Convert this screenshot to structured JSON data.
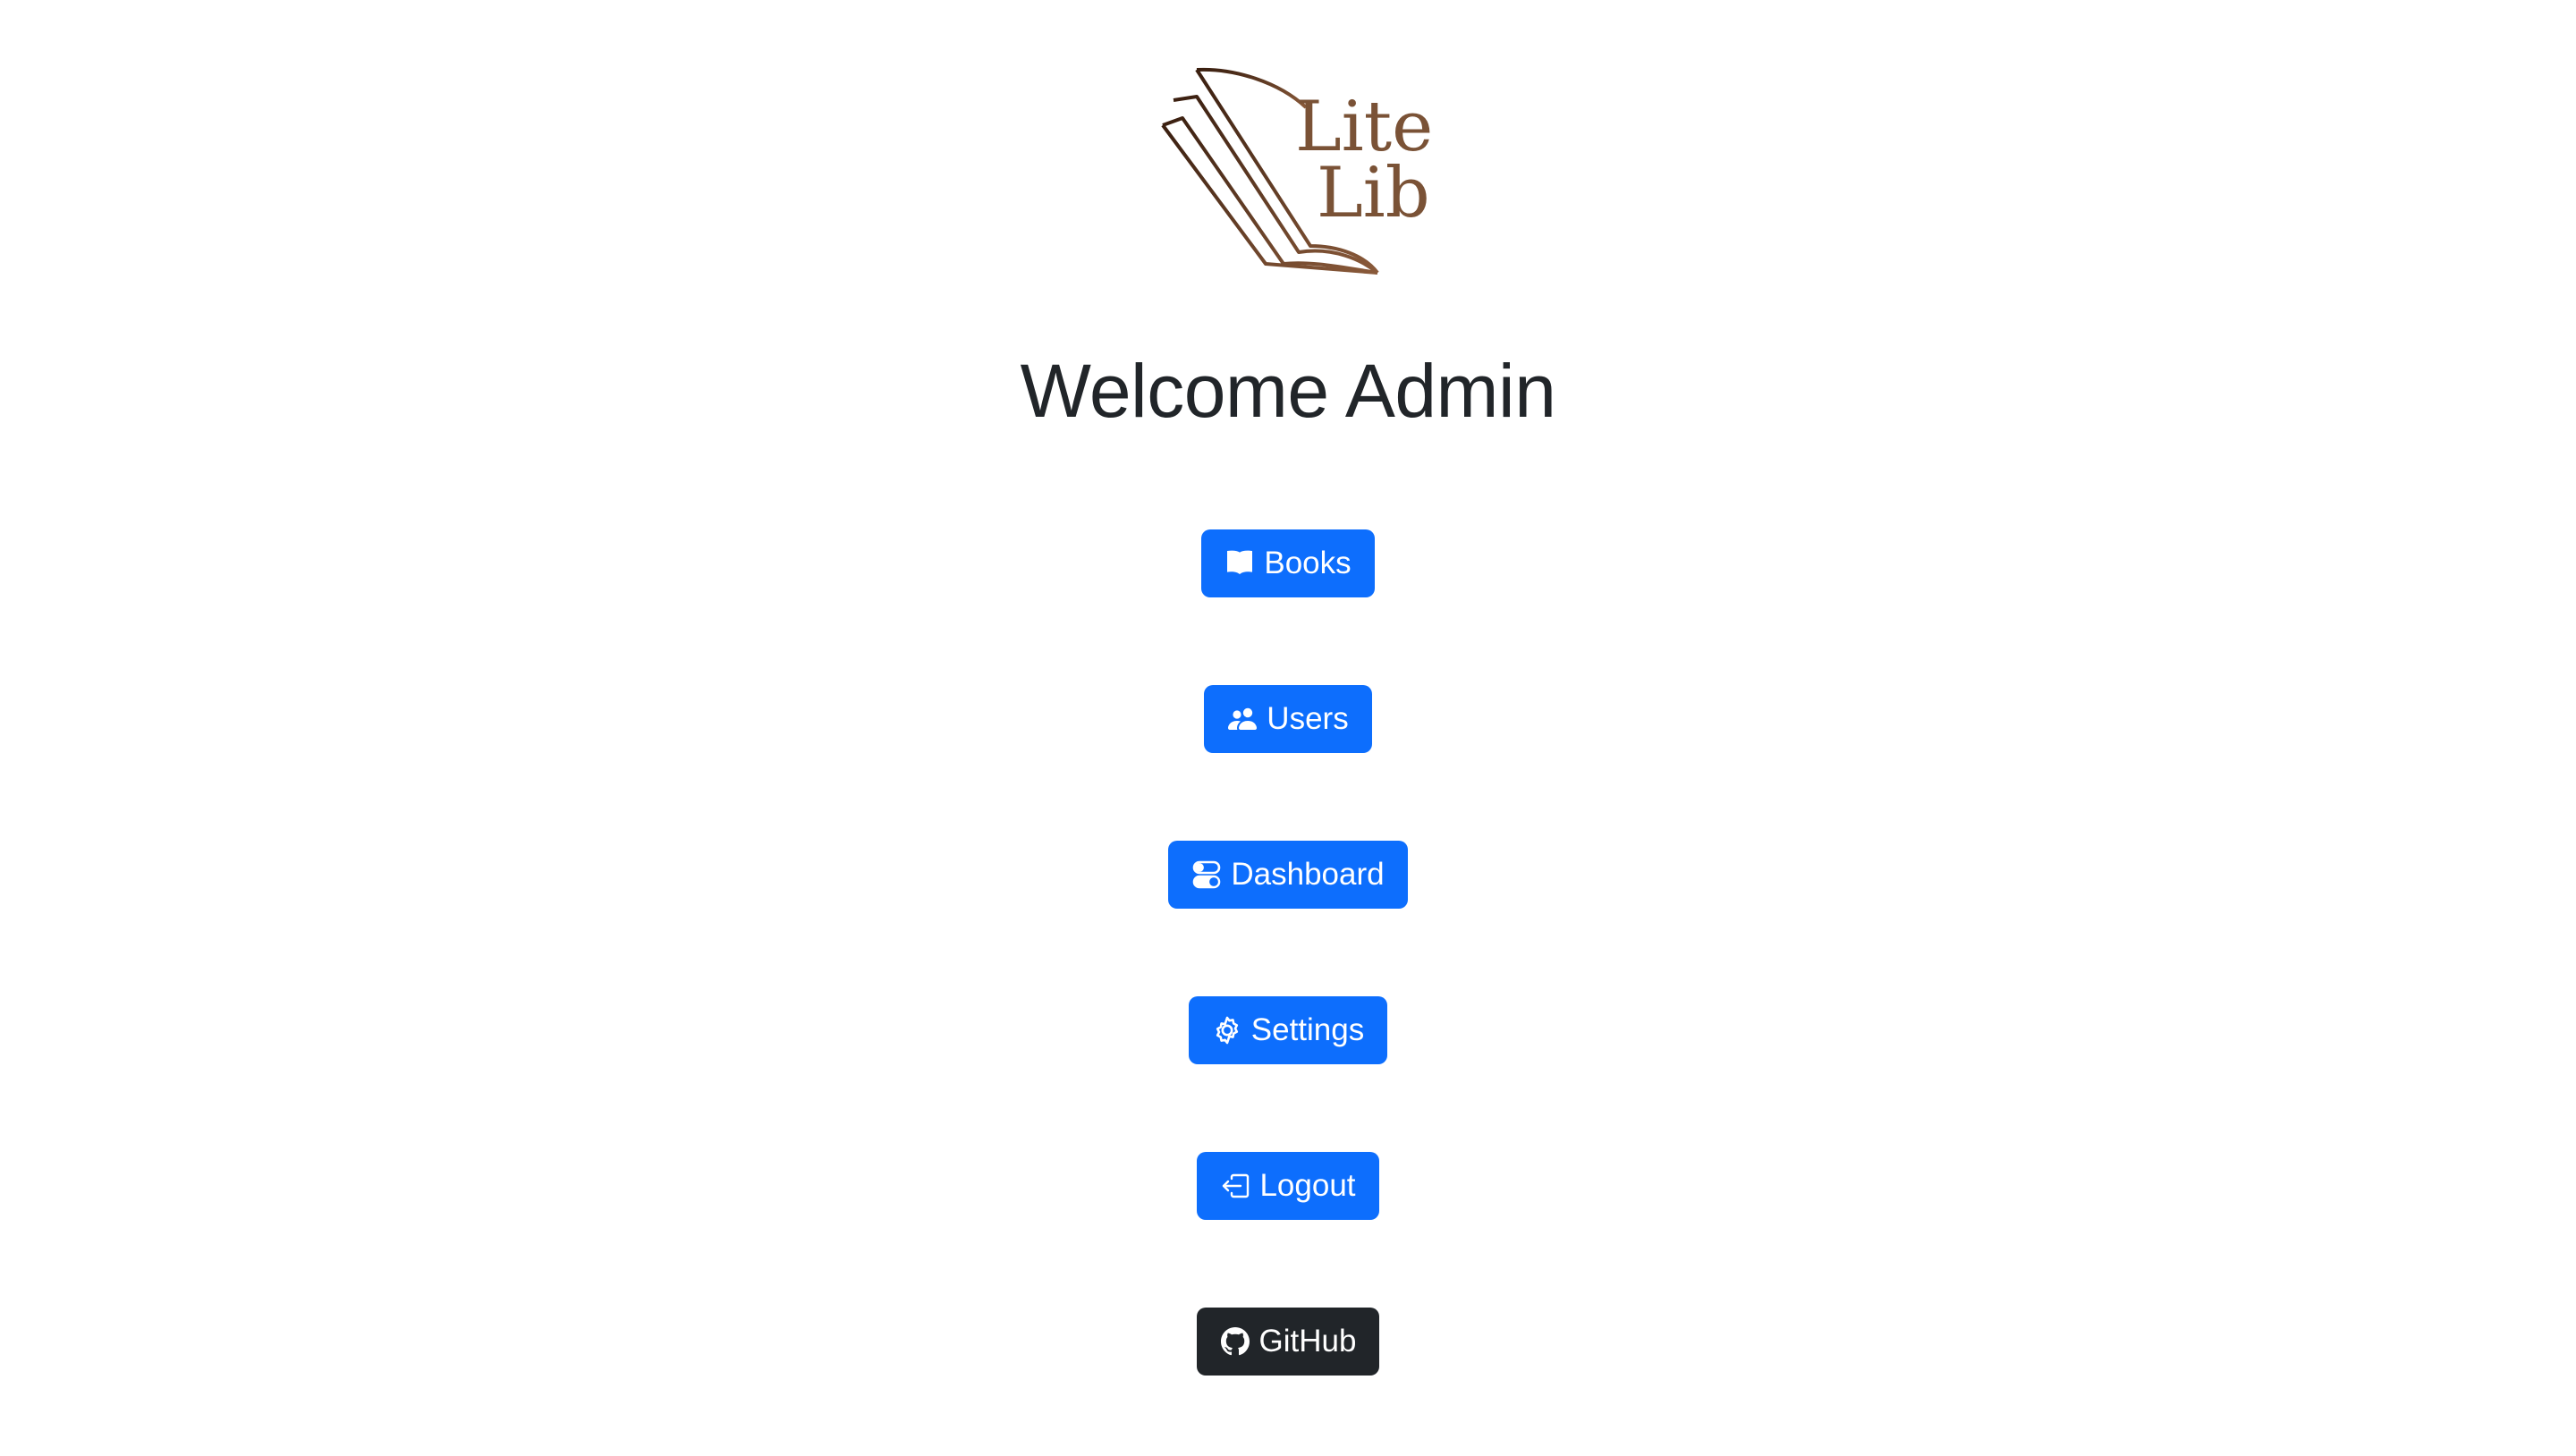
{
  "logo": {
    "line1": "Lite",
    "line2": "Lib"
  },
  "title": "Welcome Admin",
  "buttons": [
    {
      "label": "Books",
      "icon": "book-icon"
    },
    {
      "label": "Users",
      "icon": "people-icon"
    },
    {
      "label": "Dashboard",
      "icon": "toggles-icon"
    },
    {
      "label": "Settings",
      "icon": "gear-icon"
    },
    {
      "label": "Logout",
      "icon": "box-arrow-left-icon"
    },
    {
      "label": "GitHub",
      "icon": "github-icon"
    }
  ],
  "colors": {
    "primary": "#0d6efd",
    "dark": "#212529",
    "brand": "#7a5236"
  }
}
